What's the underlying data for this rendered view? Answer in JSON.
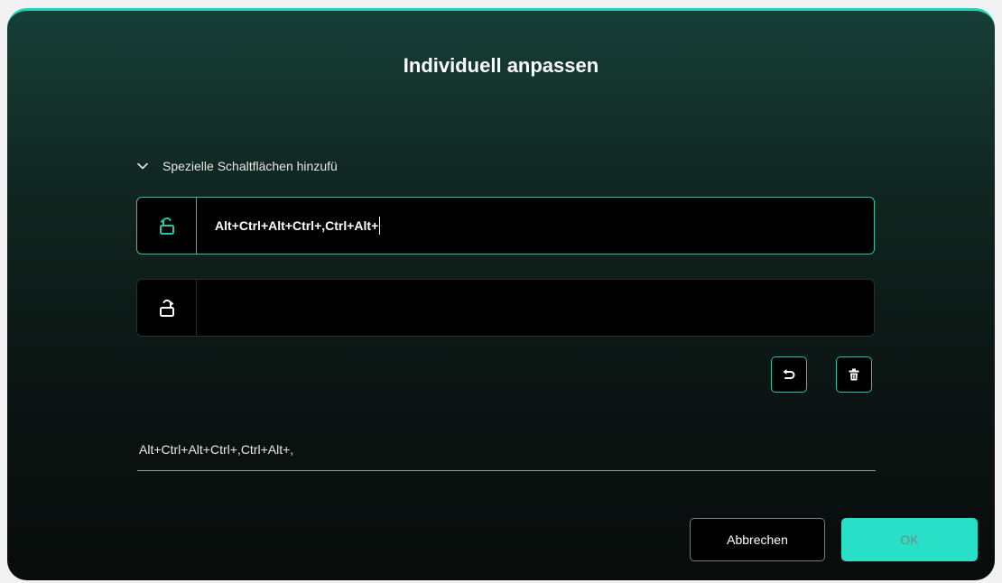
{
  "dialog": {
    "title": "Individuell anpassen",
    "section_label": "Spezielle Schaltflächen hinzufü",
    "fields": [
      {
        "icon": "rotate-left-lock-icon",
        "value": "Alt+Ctrl+Alt+Ctrl+,Ctrl+Alt+",
        "active": true
      },
      {
        "icon": "rotate-right-lock-icon",
        "value": "",
        "active": false
      }
    ],
    "preview_text": "Alt+Ctrl+Alt+Ctrl+,Ctrl+Alt+,",
    "buttons": {
      "undo_icon": "undo-icon",
      "delete_icon": "trash-icon",
      "cancel_label": "Abbrechen",
      "ok_label": "OK"
    }
  },
  "colors": {
    "accent": "#21c7a8",
    "ok_button": "#28e0c7",
    "field_background": "#000000"
  }
}
